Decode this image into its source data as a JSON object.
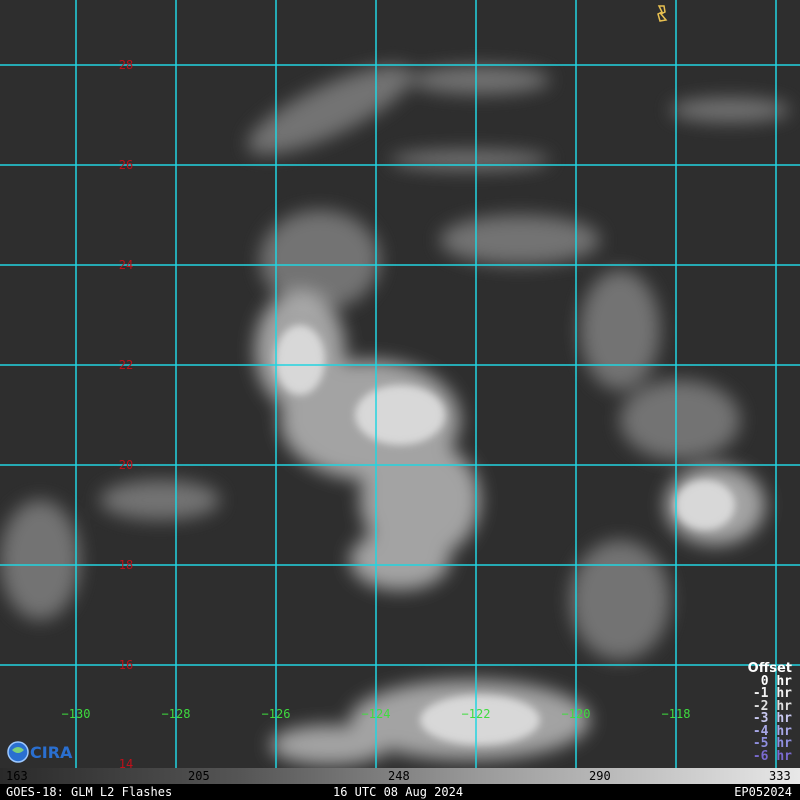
{
  "map": {
    "grid_color": "#22d4e0",
    "lat_label_color": "#c0101a",
    "lon_label_color": "#3fdc3f",
    "latitudes": [
      "28",
      "26",
      "24",
      "22",
      "20",
      "18",
      "16",
      "14"
    ],
    "longitudes": [
      "−130",
      "−128",
      "−126",
      "−124",
      "−122",
      "−120",
      "−118"
    ]
  },
  "offset_legend": {
    "title": "Offset",
    "items": [
      {
        "label": "0 hr",
        "color": "#ffffff"
      },
      {
        "label": "-1 hr",
        "color": "#f2f2f2"
      },
      {
        "label": "-2 hr",
        "color": "#e0e0e0"
      },
      {
        "label": "-3 hr",
        "color": "#c8c8f0"
      },
      {
        "label": "-4 hr",
        "color": "#a8a8e8"
      },
      {
        "label": "-5 hr",
        "color": "#8f8fe0"
      },
      {
        "label": "-6 hr",
        "color": "#7a6ad0"
      }
    ]
  },
  "colorbar": {
    "ticks": [
      "163",
      "205",
      "248",
      "290",
      "333"
    ]
  },
  "footer": {
    "left": "GOES-18: GLM L2 Flashes",
    "center": "16 UTC 08 Aug 2024",
    "right": "EP052024"
  },
  "logo": {
    "label": "CIRA",
    "icon": "cira-logo-icon"
  }
}
